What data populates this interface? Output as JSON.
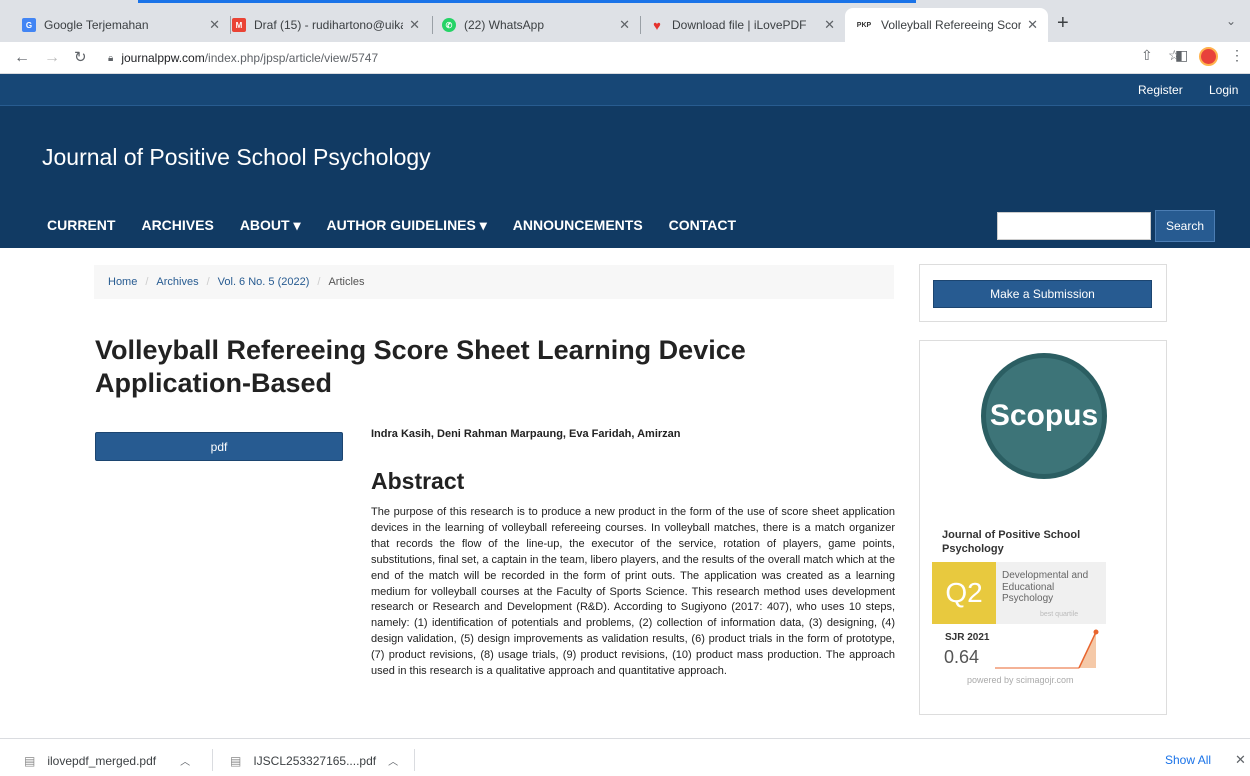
{
  "browser": {
    "tabs": [
      {
        "title": "Google Terjemahan",
        "favicon": "translate-icon",
        "color": "#4285f4"
      },
      {
        "title": "Draf (15) - rudihartono@uika-...",
        "favicon": "gmail-icon",
        "color": "#ea4335"
      },
      {
        "title": "(22) WhatsApp",
        "favicon": "whatsapp-icon",
        "color": "#25d366"
      },
      {
        "title": "Download file | iLovePDF",
        "favicon": "heart-icon",
        "color": "#e5322d"
      },
      {
        "title": "Volleyball Refereeing Score Sh...",
        "favicon": "pkp-icon",
        "color": "#ffffff",
        "favicon_text": "PKP"
      }
    ],
    "url_host": "journalppw.com",
    "url_path": "/index.php/jpsp/article/view/5747"
  },
  "site": {
    "top_links": {
      "register": "Register",
      "login": "Login"
    },
    "title": "Journal of Positive School Psychology",
    "nav": [
      "CURRENT",
      "ARCHIVES",
      "ABOUT ▾",
      "AUTHOR GUIDELINES ▾",
      "ANNOUNCEMENTS",
      "CONTACT"
    ],
    "search_label": "Search"
  },
  "breadcrumb": {
    "home": "Home",
    "archives": "Archives",
    "issue": "Vol. 6 No. 5 (2022)",
    "current": "Articles"
  },
  "article": {
    "title": "Volleyball Refereeing Score Sheet Learning Device Application-Based",
    "pdf_label": "pdf",
    "authors": "Indra Kasih, Deni Rahman Marpaung, Eva Faridah, Amirzan",
    "abstract_heading": "Abstract",
    "abstract": "The purpose of this research is to produce a new product in the form of the use of score sheet application devices in the learning of volleyball refereeing courses. In volleyball matches, there is a match organizer that records the flow of the line-up, the executor of the service, rotation of players, game points, substitutions, final set, a captain in the team, libero players, and the results of the overall match which at the end of the match will be recorded in the form of print outs. The application was created as a learning medium for volleyball courses at the Faculty of Sports Science. This research method uses development research or Research and Development (R&D). According to Sugiyono (2017: 407), who uses 10 steps, namely: (1) identification of potentials and problems, (2) collection of information data, (3) designing, (4) design validation, (5) design improvements as validation results, (6) product trials in the form of prototype, (7) product revisions, (8) usage trials, (9) product revisions, (10) product mass production. The approach used in this research is a qualitative approach and quantitative approach."
  },
  "sidebar": {
    "submit_label": "Make a Submission",
    "scopus_label": "Scopus",
    "sjr": {
      "journal": "Journal of Positive School Psychology",
      "quartile": "Q2",
      "category": "Developmental and Educational Psychology",
      "best_quartile": "best quartile",
      "year_label": "SJR 2021",
      "value": "0.64",
      "powered": "powered by scimagojr.com"
    }
  },
  "downloads": {
    "items": [
      "ilovepdf_merged.pdf",
      "IJSCL253327165....pdf"
    ],
    "show_all": "Show All"
  }
}
